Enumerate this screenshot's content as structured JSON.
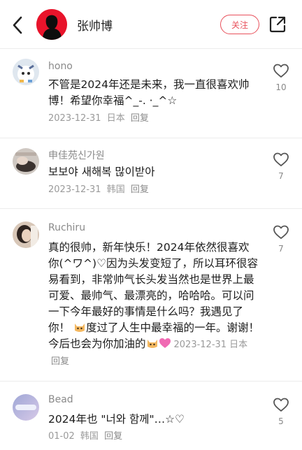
{
  "header": {
    "username": "张帅博",
    "follow_label": "关注"
  },
  "comments": [
    {
      "user": "hono",
      "text": "不管是2024年还是未来，我一直很喜欢帅博！希望你幸福^_-.  ·_^☆",
      "date": "2023-12-31",
      "country": "日本",
      "reply": "回复",
      "likes": "10"
    },
    {
      "user": "申佳苑신가원",
      "text": "보보야 새해복 많이받아",
      "date": "2023-12-31",
      "country": "韩国",
      "reply": "回复",
      "likes": "7"
    },
    {
      "user": "Ruchiru",
      "text_part1": "真的很帅，新年快乐！2024年依然很喜欢你(^ワ^)♡因为头发变短了，所以耳环很容易看到，非常帅气长头发当然也是世界上最可爱、最帅气、最漂亮的，哈哈哈。可以问一下今年最好的事情是什么吗？我遇见了你！",
      "text_part2": "度过了人生中最幸福的一年。谢谢！今后也会为你加油的",
      "date": "2023-12-31",
      "country": "日本",
      "reply": "回复",
      "likes": "7"
    },
    {
      "user": "Bead",
      "text": "2024年也 \"너와 함께\"…☆♡",
      "date": "01-02",
      "country": "韩国",
      "reply": "回复",
      "likes": "5"
    }
  ]
}
